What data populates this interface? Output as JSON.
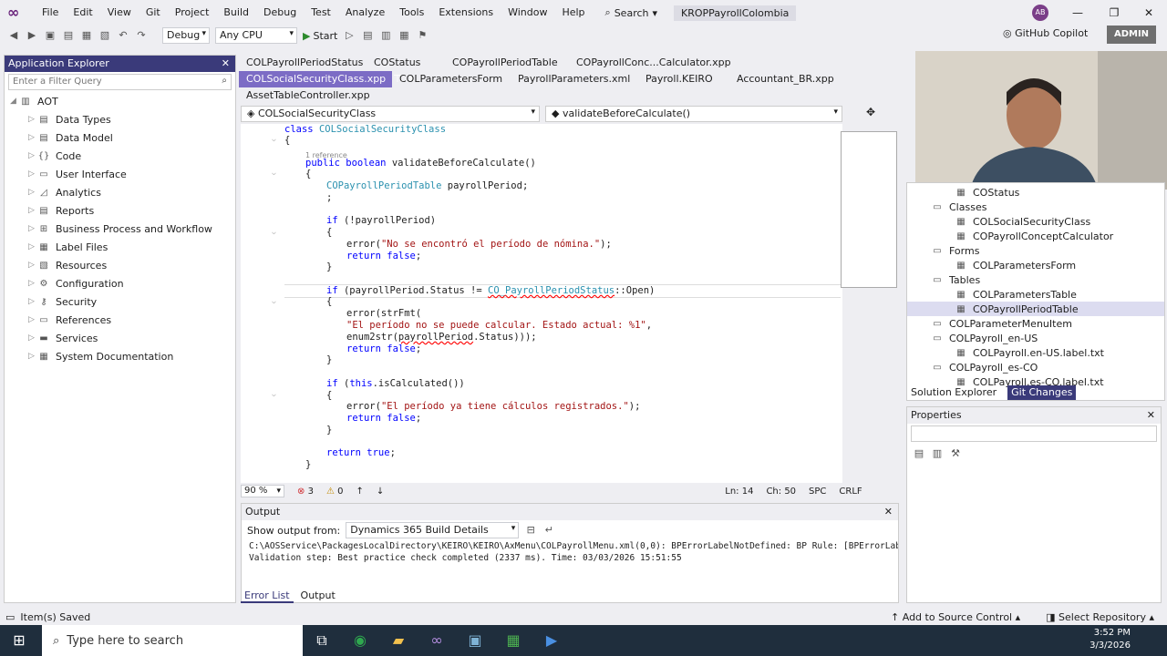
{
  "menubar": {
    "items": [
      "File",
      "Edit",
      "View",
      "Git",
      "Project",
      "Build",
      "Debug",
      "Test",
      "Analyze",
      "Tools",
      "Extensions",
      "Window",
      "Help"
    ],
    "search": "Search",
    "project_title": "KROPPayrollColombia",
    "avatar": "AB"
  },
  "toolbar": {
    "config": "Debug",
    "platform": "Any CPU",
    "start": "Start",
    "copilot": "GitHub Copilot",
    "admin": "ADMIN"
  },
  "app_explorer": {
    "title": "Application Explorer",
    "filter_placeholder": "Enter a Filter Query",
    "root": "AOT",
    "items": [
      "Data Types",
      "Data Model",
      "Code",
      "User Interface",
      "Analytics",
      "Reports",
      "Business Process and Workflow",
      "Label Files",
      "Resources",
      "Configuration",
      "Security",
      "References",
      "Services",
      "System Documentation"
    ]
  },
  "tabs": {
    "row1": [
      "COLPayrollPeriodStatus",
      "COStatus",
      "COPayrollPeriodTable",
      "COPayrollConc...Calculator.xpp"
    ],
    "row2": [
      "COLSocialSecurityClass.xpp",
      "COLParametersForm",
      "PayrollParameters.xml",
      "Payroll.KEIRO",
      "Accountant_BR.xpp"
    ],
    "row3": [
      "AssetTableController.xpp"
    ]
  },
  "nav": {
    "class": "COLSocialSecurityClass",
    "method": "validateBeforeCalculate()"
  },
  "code": {
    "l1a": "class ",
    "l1b": "COLSocialSecurityClass",
    "l2": "{",
    "ref": "1 reference",
    "l3a": "public boolean ",
    "l3b": "validateBeforeCalculate()",
    "l4": "{",
    "l5a": "COPayrollPeriodTable",
    "l5b": " payrollPeriod;",
    "l6": ";",
    "l7a": "if",
    "l7b": " (!payrollPeriod)",
    "l8": "{",
    "l9a": "error(",
    "l9b": "\"No se encontró el período de nómina.\"",
    "l9c": ");",
    "l10a": "return ",
    "l10b": "false",
    "l10c": ";",
    "l11": "}",
    "l12a": "if",
    "l12b": " (payrollPeriod.Status != ",
    "l12c": "CO_PayrollPeriodStatus",
    "l12d": "::Open)",
    "l13": "{",
    "l14": "error(strFmt(",
    "l15a": "\"El período no se puede calcular. Estado actual: %1\"",
    "l15b": ",",
    "l16a": "enum2str(",
    "l16b": "payrollPeriod",
    "l16c": ".Status)));",
    "l17a": "return ",
    "l17b": "false",
    "l17c": ";",
    "l18": "}",
    "l19a": "if",
    "l19b": " (",
    "l19c": "this",
    "l19d": ".isCalculated())",
    "l20": "{",
    "l21a": "error(",
    "l21b": "\"El período ya tiene cálculos registrados.\"",
    "l21c": ");",
    "l22a": "return ",
    "l22b": "false",
    "l22c": ";",
    "l23": "}",
    "l24a": "return ",
    "l24b": "true",
    "l24c": ";",
    "l25": "}"
  },
  "editor_status": {
    "zoom": "90 %",
    "errors": "3",
    "warnings": "0",
    "line": "Ln: 14",
    "col": "Ch: 50",
    "spc": "SPC",
    "crlf": "CRLF"
  },
  "output": {
    "title": "Output",
    "show_label": "Show output from:",
    "source": "Dynamics 365 Build Details",
    "line1": "C:\\AOSService\\PackagesLocalDirectory\\KEIRO\\KEIRO\\AxMenu\\COLPayrollMenu.xml(0,0): BPErrorLabelNotDefined: BP Rule: [BPErrorLabelNo",
    "line2": "Validation step: Best practice check completed (2337 ms). Time: 03/03/2026 15:51:55",
    "tab_errors": "Error List",
    "tab_output": "Output"
  },
  "solution": {
    "items": [
      {
        "t": "COStatus",
        "l": 3
      },
      {
        "t": "Classes",
        "l": 2
      },
      {
        "t": "COLSocialSecurityClass",
        "l": 3
      },
      {
        "t": "COPayrollConceptCalculator",
        "l": 3
      },
      {
        "t": "Forms",
        "l": 2
      },
      {
        "t": "COLParametersForm",
        "l": 3
      },
      {
        "t": "Tables",
        "l": 2
      },
      {
        "t": "COLParametersTable",
        "l": 3
      },
      {
        "t": "COPayrollPeriodTable",
        "l": 3
      },
      {
        "t": "COLParameterMenuItem",
        "l": 2
      },
      {
        "t": "COLPayroll_en-US",
        "l": 2
      },
      {
        "t": "COLPayroll.en-US.label.txt",
        "l": 3
      },
      {
        "t": "COLPayroll_es-CO",
        "l": 2
      },
      {
        "t": "COLPayroll.es-CO.label.txt",
        "l": 3
      }
    ],
    "tab_solution": "Solution Explorer",
    "tab_git": "Git Changes"
  },
  "properties": {
    "title": "Properties"
  },
  "statusbar": {
    "saved": "Item(s) Saved",
    "source_control": "Add to Source Control",
    "repo": "Select Repository"
  },
  "taskbar": {
    "search": "Type here to search",
    "time": "3:52 PM",
    "date": "3/3/2026"
  },
  "colors": {
    "accent": "#68217a",
    "tab_active": "#7c6cc5",
    "panel_header": "#3a3a7a"
  }
}
